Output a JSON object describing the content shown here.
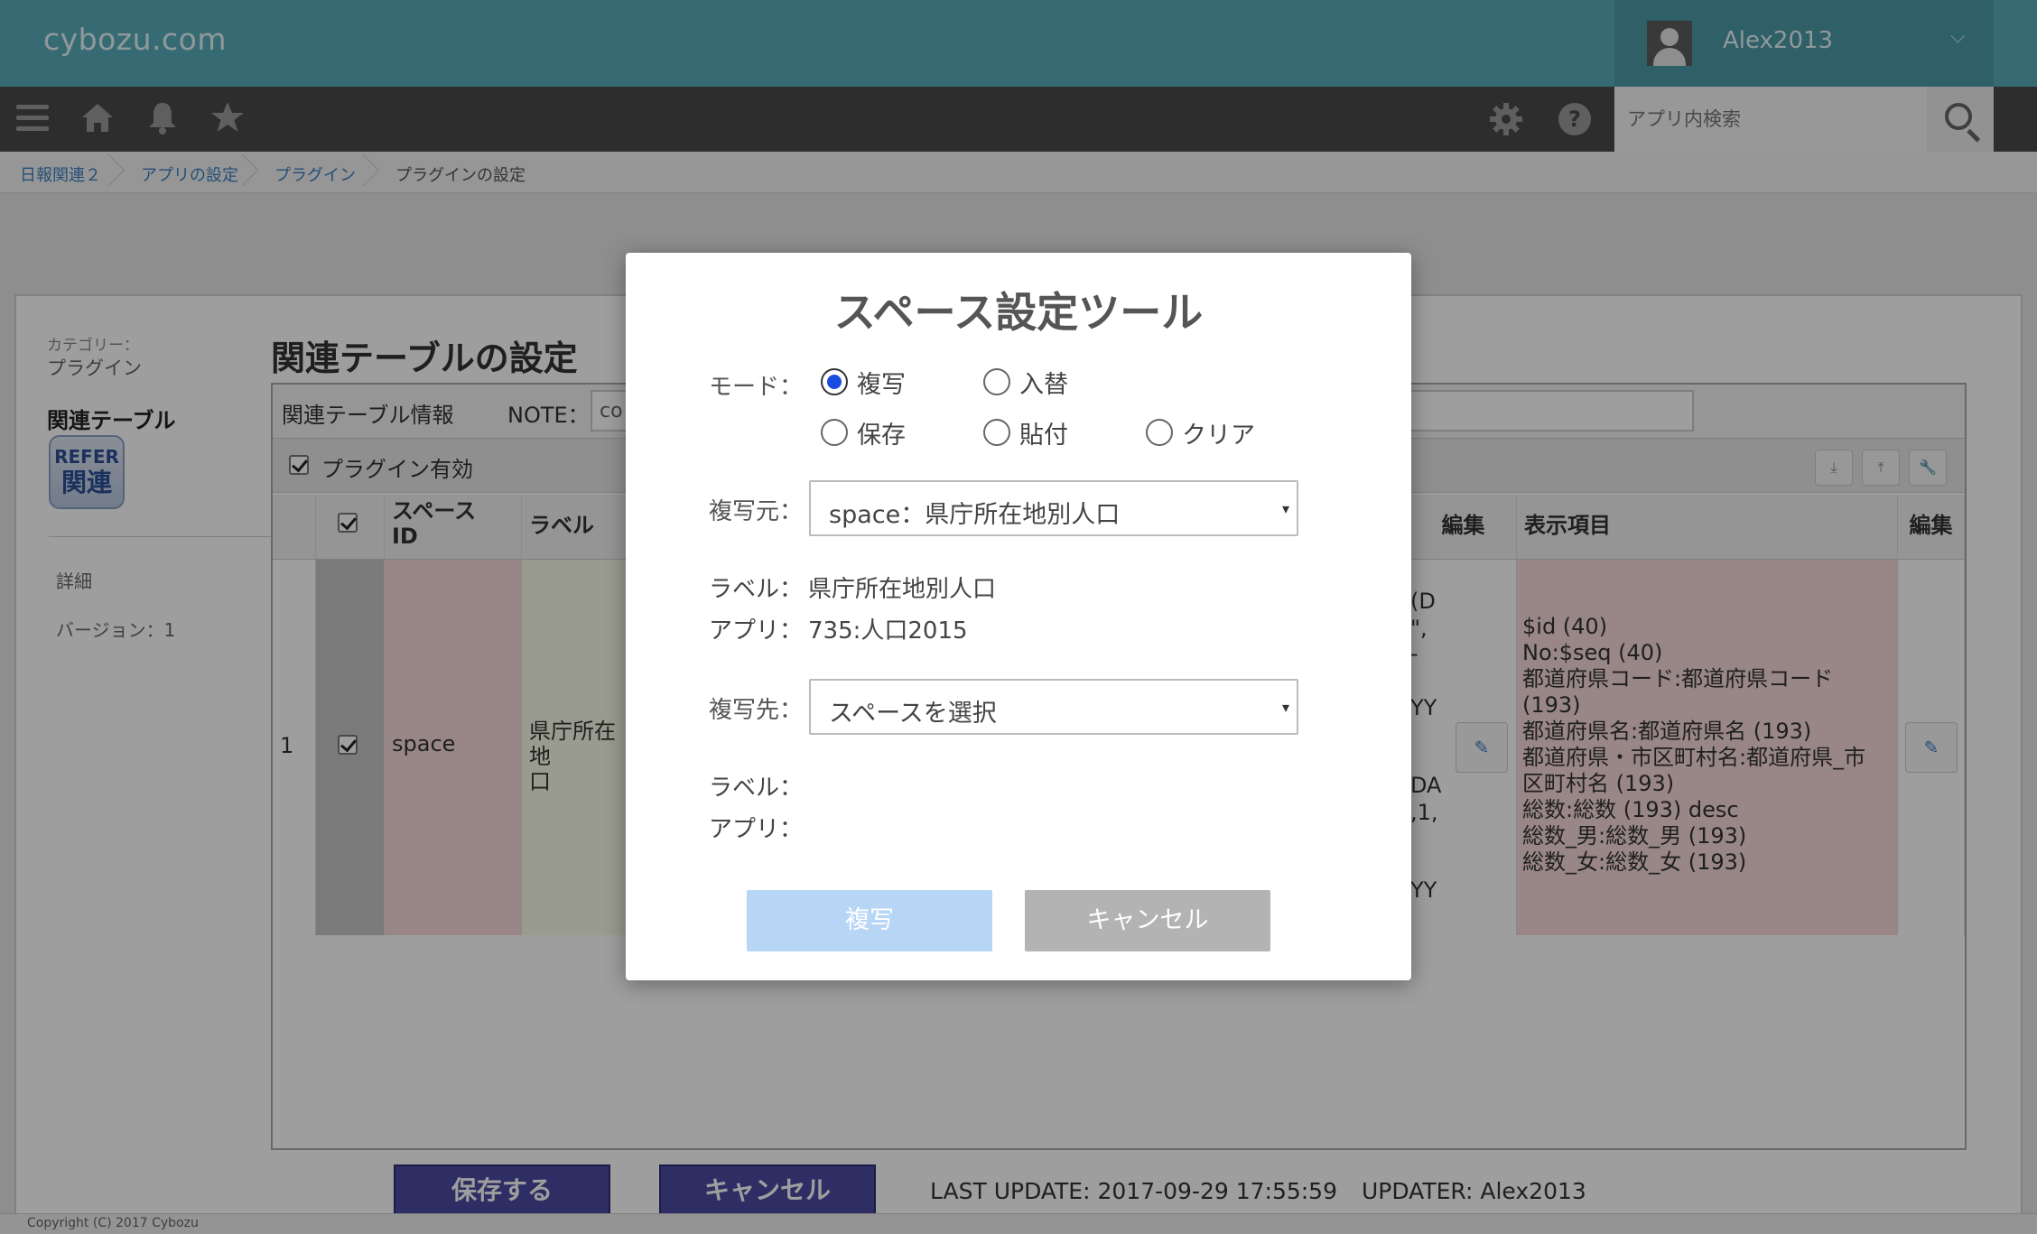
{
  "header": {
    "logo": "cybozu.com",
    "username": "Alex2013",
    "user_chevron": "⌵",
    "search_placeholder": "アプリ内検索"
  },
  "breadcrumb": [
    "日報関連２",
    "アプリの設定",
    "プラグイン",
    "プラグインの設定"
  ],
  "sidebar": {
    "category_label": "カテゴリー：",
    "category_value": "プラグイン",
    "plugin_name": "関連テーブル",
    "badge_top": "REFER",
    "badge_bottom": "関連",
    "links": [
      "詳細",
      "バージョン：1"
    ]
  },
  "main": {
    "title": "関連テーブルの設定",
    "info_label": "関連テーブル情報",
    "note_label": "NOTE：",
    "note_value": "co",
    "plugin_enabled_label": "プラグイン有効",
    "tool_icons": [
      "⤓",
      "⤒",
      "🔧"
    ],
    "columns": {
      "space_id": "スペース\nID",
      "label": "ラベル",
      "edit": "編集",
      "display_items": "表示項目",
      "edit2": "編集"
    },
    "row": {
      "number": "1",
      "space_id": "space",
      "label_partial": "県庁所在地\n口",
      "hidden_fragments": [
        "(D",
        "\",",
        "-",
        "YY",
        "DA",
        ",1,",
        "YY"
      ],
      "display_items": [
        "$id (40)",
        "No:$seq (40)",
        "都道府県コード:都道府県コード",
        "(193)",
        "都道府県名:都道府県名 (193)",
        "都道府県・市区町村名:都道府県_市",
        "区町村名 (193)",
        "総数:総数 (193) desc",
        "総数_男:総数_男 (193)",
        "総数_女:総数_女 (193)"
      ]
    },
    "save_button": "保存する",
    "cancel_button": "キャンセル",
    "last_update": "LAST UPDATE: 2017-09-29 17:55:59",
    "updater": "UPDATER: Alex2013"
  },
  "footer": "Copyright (C) 2017 Cybozu",
  "modal": {
    "title": "スペース設定ツール",
    "mode_label": "モード：",
    "modes": [
      {
        "label": "複写",
        "checked": true
      },
      {
        "label": "入替",
        "checked": false
      },
      {
        "label": "保存",
        "checked": false
      },
      {
        "label": "貼付",
        "checked": false
      },
      {
        "label": "クリア",
        "checked": false
      }
    ],
    "source_label": "複写元：",
    "source_value": "space：県庁所在地別人口",
    "source_info_label_key": "ラベル：",
    "source_info_label_value": "県庁所在地別人口",
    "source_info_app_key": "アプリ：",
    "source_info_app_value": "735:人口2015",
    "dest_label": "複写先：",
    "dest_value": "スペースを選択",
    "dest_info_label_key": "ラベル：",
    "dest_info_app_key": "アプリ：",
    "dropdown_arrow": "▾",
    "copy_button": "複写",
    "cancel_button": "キャンセル"
  },
  "colors": {
    "header": "#5aadbc",
    "navbar": "#4a4a4a",
    "modal_primary_disabled": "#b7d6f6",
    "modal_secondary": "#b3b3b3",
    "save_button": "#4b4aa2"
  }
}
